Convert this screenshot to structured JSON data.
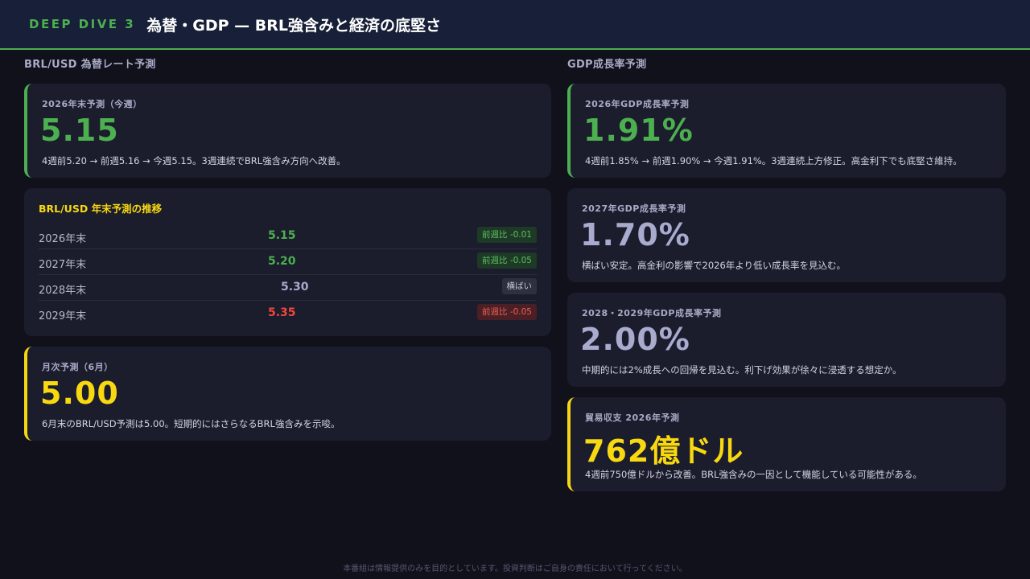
{
  "header": {
    "tag": "DEEP DIVE 3",
    "title": "為替・GDP — BRL強含みと経済の底堅さ"
  },
  "left": {
    "section_title": "BRL/USD 為替レート予測",
    "card_main": {
      "label": "2026年末予測（今週）",
      "value": "5.15",
      "desc": "4週前5.20 → 前週5.16 → 今週5.15。3週連続でBRL強含み方向へ改善。"
    },
    "table": {
      "title": "BRL/USD 年末予測の推移",
      "rows": [
        {
          "year": "2026年末",
          "value": "5.15",
          "badge": "前週比 -0.01"
        },
        {
          "year": "2027年末",
          "value": "5.20",
          "badge": "前週比 -0.05"
        },
        {
          "year": "2028年末",
          "value": "5.30",
          "badge": "横ばい"
        },
        {
          "year": "2029年末",
          "value": "5.35",
          "badge": "前週比 -0.05"
        }
      ]
    },
    "card_monthly": {
      "label": "月次予測（6月）",
      "value": "5.00",
      "desc": "6月末のBRL/USD予測は5.00。短期的にはさらなるBRL強含みを示唆。"
    }
  },
  "right": {
    "section_title": "GDP成長率予測",
    "card_2026": {
      "label": "2026年GDP成長率予測",
      "value": "1.91%",
      "desc": "4週前1.85% → 前週1.90% → 今週1.91%。3週連続上方修正。高金利下でも底堅さ維持。"
    },
    "card_2027": {
      "label": "2027年GDP成長率予測",
      "value": "1.70%",
      "desc": "横ばい安定。高金利の影響で2026年より低い成長率を見込む。"
    },
    "card_2028": {
      "label": "2028・2029年GDP成長率予測",
      "value": "2.00%",
      "desc": "中期的には2%成長への回帰を見込む。利下げ効果が徐々に浸透する想定か。"
    },
    "card_trade": {
      "label": "貿易収支 2026年予測",
      "value": "762億ドル",
      "desc": "4週前750億ドルから改善。BRL強含みの一因として機能している可能性がある。"
    }
  },
  "footer": "本番組は情報提供のみを目的としています。投資判断はご自身の責任において行ってください。",
  "colors": {
    "accent_green": "#4caf50",
    "accent_yellow": "#f7d811",
    "negative_red": "#f0483c",
    "neutral": "#a8abce"
  }
}
